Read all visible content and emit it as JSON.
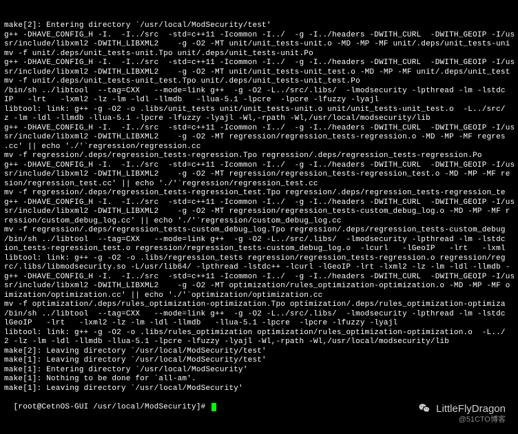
{
  "lines": [
    "make[2]: Entering directory `/usr/local/ModSecurity/test'",
    "g++ -DHAVE_CONFIG_H -I.  -I../src  -std=c++11 -Icommon -I../  -g -I../headers -DWITH_CURL  -DWITH_GEOIP -I/us",
    "sr/include/libxml2 -DWITH_LIBXML2    -g -O2 -MT unit/unit_tests-unit.o -MD -MP -MF unit/.deps/unit_tests-uni",
    "mv -f unit/.deps/unit_tests-unit.Tpo unit/.deps/unit_tests-unit.Po",
    "g++ -DHAVE_CONFIG_H -I.  -I../src  -std=c++11 -Icommon -I../  -g -I../headers -DWITH_CURL  -DWITH_GEOIP -I/us",
    "sr/include/libxml2 -DWITH_LIBXML2    -g -O2 -MT unit/unit_tests-unit_test.o -MD -MP -MF unit/.deps/unit_test",
    "mv -f unit/.deps/unit_tests-unit_test.Tpo unit/.deps/unit_tests-unit_test.Po",
    "/bin/sh ../libtool  --tag=CXX   --mode=link g++  -g -O2 -L../src/.libs/  -lmodsecurity -lpthread -lm -lstdc",
    "IP   -lrt   -lxml2 -lz -lm -ldl -llmdb   -llua-5.1 -lpcre  -lpcre -lfuzzy -lyajl",
    "libtool: link: g++ -g -O2 -o .libs/unit_tests unit/unit_tests-unit.o unit/unit_tests-unit_test.o  -L../src/",
    "z -lm -ldl -llmdb -llua-5.1 -lpcre -lfuzzy -lyajl -Wl,-rpath -Wl,/usr/local/modsecurity/lib",
    "g++ -DHAVE_CONFIG_H -I.  -I../src  -std=c++11 -Icommon -I../  -g -I../headers -DWITH_CURL  -DWITH_GEOIP -I/us",
    "sr/include/libxml2 -DWITH_LIBXML2    -g -O2 -MT regression/regression_tests-regression.o -MD -MP -MF regres",
    ".cc' || echo './'`regression/regression.cc",
    "mv -f regression/.deps/regression_tests-regression.Tpo regression/.deps/regression_tests-regression.Po",
    "g++ -DHAVE_CONFIG_H -I.  -I../src  -std=c++11 -Icommon -I../  -g -I../headers -DWITH_CURL  -DWITH_GEOIP -I/us",
    "sr/include/libxml2 -DWITH_LIBXML2    -g -O2 -MT regression/regression_tests-regression_test.o -MD -MP -MF re",
    "sion/regression_test.cc' || echo './'`regression/regression_test.cc",
    "mv -f regression/.deps/regression_tests-regression_test.Tpo regression/.deps/regression_tests-regression_te",
    "g++ -DHAVE_CONFIG_H -I.  -I../src  -std=c++11 -Icommon -I../  -g -I../headers -DWITH_CURL  -DWITH_GEOIP -I/us",
    "sr/include/libxml2 -DWITH_LIBXML2    -g -O2 -MT regression/regression_tests-custom_debug_log.o -MD -MP -MF r",
    "ression/custom_debug_log.cc' || echo './'`regression/custom_debug_log.cc",
    "mv -f regression/.deps/regression_tests-custom_debug_log.Tpo regression/.deps/regression_tests-custom_debug",
    "/bin/sh ../libtool  --tag=CXX   --mode=link g++  -g -O2 -L../src/.libs/  -lmodsecurity -lpthread -lm -lstdc",
    "ion_tests-regression_test.o regression/regression_tests-custom_debug_log.o  -lcurl   -lGeoIP   -lrt   -lxml",
    "libtool: link: g++ -g -O2 -o .libs/regression_tests regression/regression_tests-regression.o regression/reg",
    "rc/.libs/libmodsecurity.so -L/usr/lib64/ -lpthread -lstdc++ -lcurl -lGeoIP -lrt -lxml2 -lz -lm -ldl -llmdb -",
    "g++ -DHAVE_CONFIG_H -I.  -I../src  -std=c++11 -Icommon -I../  -g -I../headers -DWITH_CURL  -DWITH_GEOIP -I/us",
    "sr/include/libxml2 -DWITH_LIBXML2    -g -O2 -MT optimization/rules_optimization-optimization.o -MD -MP -MF o",
    "imization/optimization.cc' || echo './'`optimization/optimization.cc",
    "mv -f optimization/.deps/rules_optimization-optimization.Tpo optimization/.deps/rules_optimization-optimiza",
    "/bin/sh ../libtool  --tag=CXX   --mode=link g++  -g -O2 -L../src/.libs/  -lmodsecurity -lpthread -lm -lstdc",
    "lGeoIP   -lrt   -lxml2 -lz -lm -ldl -llmdb   -llua-5.1 -lpcre  -lpcre -lfuzzy -lyajl",
    "libtool: link: g++ -g -O2 -o .libs/rules_optimization optimization/rules_optimization-optimization.o  -L../",
    "2 -lz -lm -ldl -llmdb -llua-5.1 -lpcre -lfuzzy -lyajl -Wl,-rpath -Wl,/usr/local/modsecurity/lib",
    "make[2]: Leaving directory `/usr/local/ModSecurity/test'",
    "make[1]: Leaving directory `/usr/local/ModSecurity/test'",
    "make[1]: Entering directory `/usr/local/ModSecurity'",
    "make[1]: Nothing to be done for `all-am'.",
    "make[1]: Leaving directory `/usr/local/ModSecurity'"
  ],
  "prompt": "[root@CetnOS-GUI /usr/local/ModSecurity]# ",
  "watermark": {
    "name": "LittleFlyDragon",
    "sub": "@51CTO博客"
  }
}
